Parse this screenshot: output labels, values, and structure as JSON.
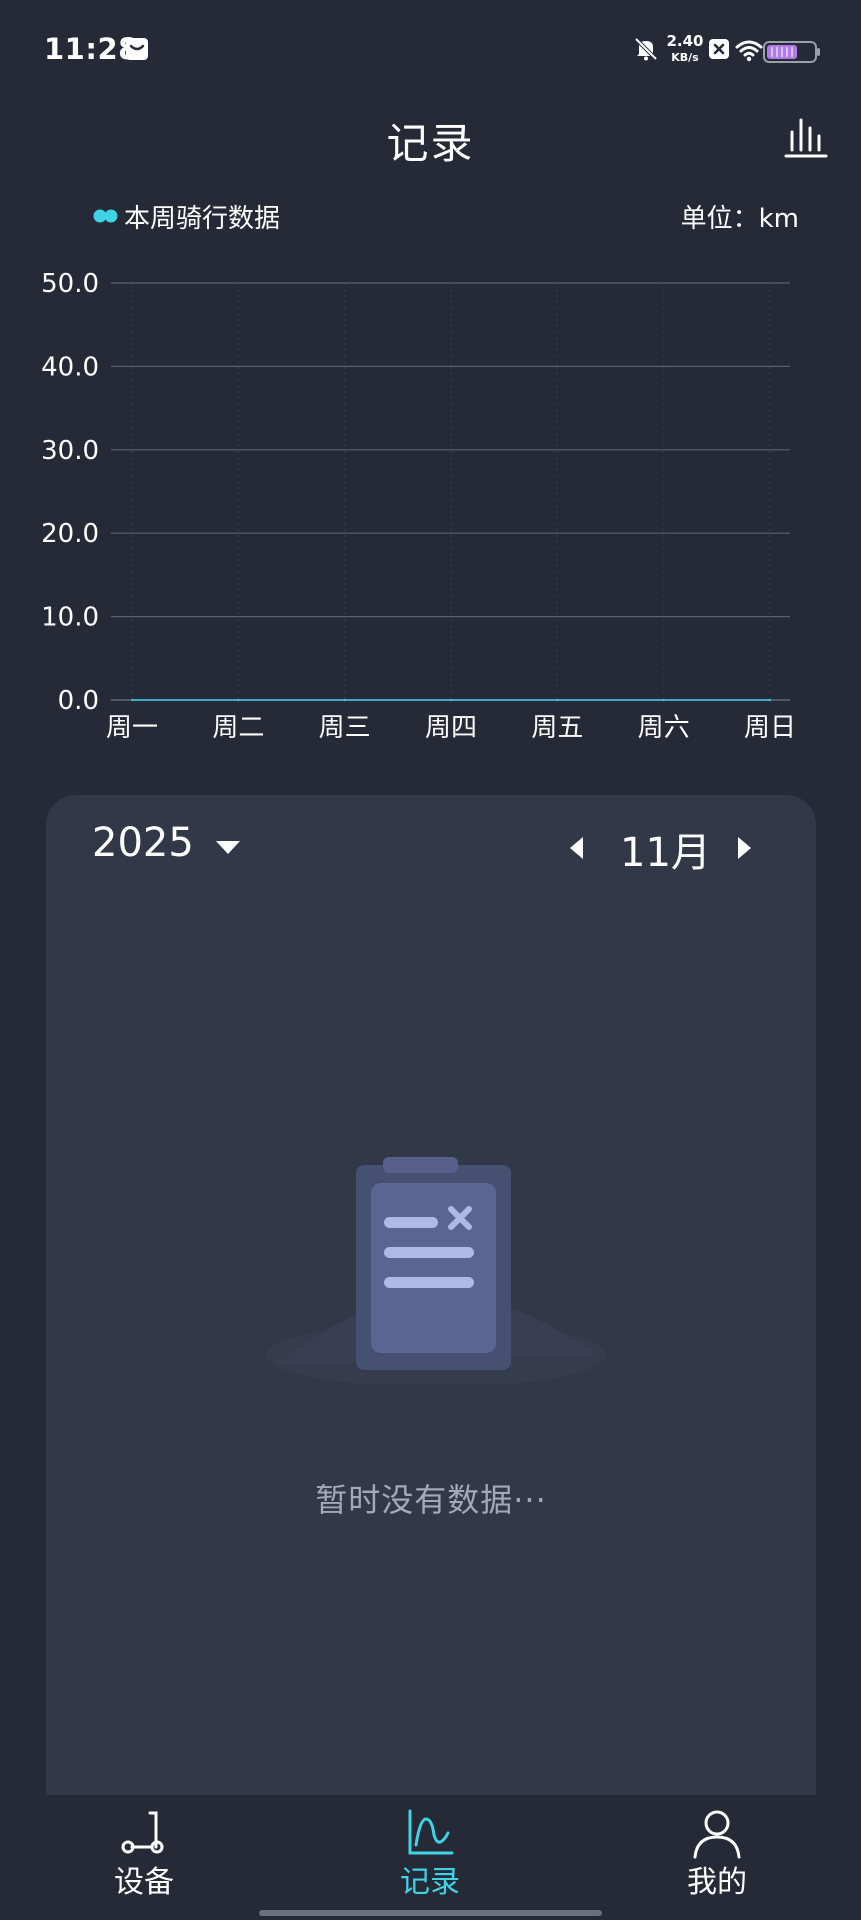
{
  "status_bar": {
    "time": "11:28",
    "net_speed_value": "2.40",
    "net_speed_unit": "KB/s",
    "battery_color": "#b07be8"
  },
  "header": {
    "title": "记录",
    "stats_icon": "bar-chart-icon"
  },
  "legend": {
    "label": "本周骑行数据",
    "dot_color": "#3fd3e6",
    "unit": "单位：km"
  },
  "chart_data": {
    "type": "line",
    "categories": [
      "周一",
      "周二",
      "周三",
      "周四",
      "周五",
      "周六",
      "周日"
    ],
    "series": [
      {
        "name": "本周骑行数据",
        "values": [
          0.0,
          0.0,
          0.0,
          0.0,
          0.0,
          0.0,
          0.0
        ]
      }
    ],
    "y_ticks": [
      "50.0",
      "40.0",
      "30.0",
      "20.0",
      "10.0",
      "0.0"
    ],
    "ylim": [
      0,
      50
    ],
    "grid": true,
    "line_color": "#3fd3e6"
  },
  "calendar": {
    "year": "2025",
    "month": "11月",
    "empty_text": "暂时没有数据···"
  },
  "bottom_nav": {
    "items": [
      {
        "label": "设备",
        "icon": "scooter-icon",
        "active": false
      },
      {
        "label": "记录",
        "icon": "records-chart-icon",
        "active": true
      },
      {
        "label": "我的",
        "icon": "user-icon",
        "active": false
      }
    ],
    "active_color": "#3fd3e6"
  }
}
